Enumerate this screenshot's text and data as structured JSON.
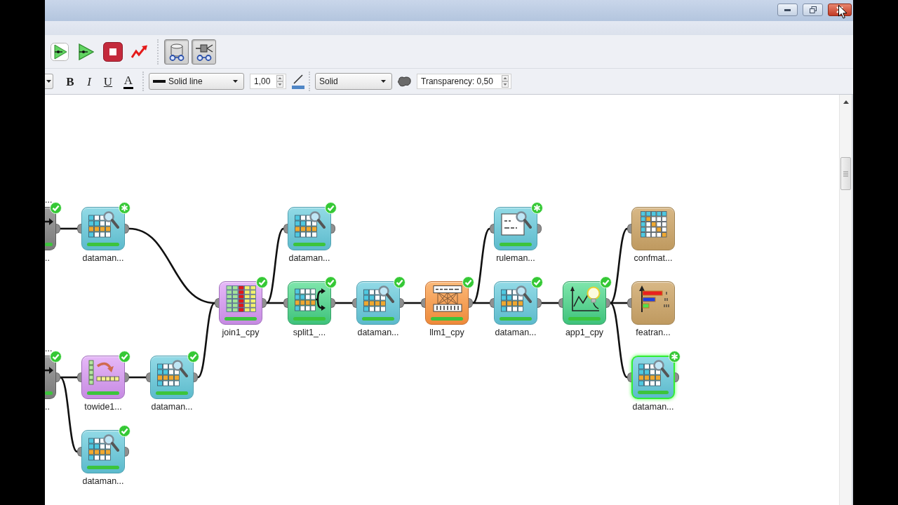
{
  "toolbar": {
    "buttons": [
      {
        "kind": "run",
        "pressed": false
      },
      {
        "kind": "run-step",
        "pressed": false
      },
      {
        "kind": "stop",
        "pressed": false
      },
      {
        "kind": "chart",
        "pressed": false
      },
      {
        "kind": "data-view",
        "pressed": true
      },
      {
        "kind": "node-view",
        "pressed": true
      }
    ]
  },
  "format_bar": {
    "style_buttons": [
      {
        "kind": "bold",
        "label": "B"
      },
      {
        "kind": "italic",
        "label": "I"
      },
      {
        "kind": "underline",
        "label": "U"
      },
      {
        "kind": "font-color",
        "label": "A"
      }
    ],
    "line_style": {
      "value": "Solid line"
    },
    "line_width": {
      "value": "1,00"
    },
    "fill_style": {
      "value": "Solid"
    },
    "transparency": {
      "value": "Transparency: 0,50"
    }
  },
  "canvas": {
    "nodes": [
      {
        "kind": "source",
        "note": "...",
        "label": "..",
        "executed": true,
        "modified": false,
        "selected": false
      },
      {
        "kind": "viewer",
        "label": "dataman...",
        "executed": true,
        "modified": true,
        "selected": false
      },
      {
        "kind": "viewer",
        "label": "dataman...",
        "executed": true,
        "modified": false,
        "selected": false
      },
      {
        "kind": "rule-viewer",
        "label": "ruleman...",
        "executed": true,
        "modified": true,
        "selected": false
      },
      {
        "kind": "confusion-matrix",
        "label": "confmat...",
        "executed": false,
        "modified": false,
        "selected": false
      },
      {
        "kind": "join",
        "label": "join1_cpy",
        "executed": true,
        "modified": false,
        "selected": false
      },
      {
        "kind": "split",
        "label": "split1_...",
        "executed": true,
        "modified": false,
        "selected": false
      },
      {
        "kind": "viewer",
        "label": "dataman...",
        "executed": true,
        "modified": false,
        "selected": false
      },
      {
        "kind": "model",
        "label": "llm1_cpy",
        "executed": true,
        "modified": false,
        "selected": false
      },
      {
        "kind": "viewer",
        "label": "dataman...",
        "executed": true,
        "modified": false,
        "selected": false
      },
      {
        "kind": "apply",
        "label": "app1_cpy",
        "executed": true,
        "modified": false,
        "selected": false
      },
      {
        "kind": "feature-ranking",
        "label": "featran...",
        "executed": false,
        "modified": false,
        "selected": false
      },
      {
        "kind": "source",
        "note": "...",
        "label": "..",
        "executed": true,
        "modified": false,
        "selected": false
      },
      {
        "kind": "reshape",
        "label": "towide1...",
        "executed": true,
        "modified": false,
        "selected": false
      },
      {
        "kind": "viewer",
        "label": "dataman...",
        "executed": true,
        "modified": false,
        "selected": false
      },
      {
        "kind": "viewer",
        "label": "dataman...",
        "executed": true,
        "modified": true,
        "selected": true
      },
      {
        "kind": "viewer",
        "label": "dataman...",
        "executed": true,
        "modified": false,
        "selected": false
      }
    ]
  }
}
